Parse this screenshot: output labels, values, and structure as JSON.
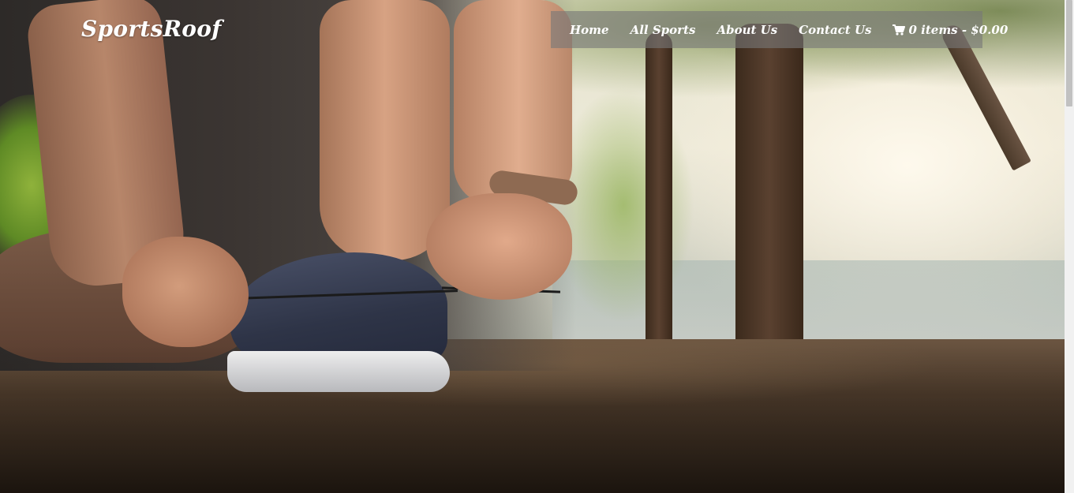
{
  "brand": {
    "logo_text": "SportsRoof"
  },
  "nav": {
    "items": [
      {
        "label": "Home"
      },
      {
        "label": "All Sports"
      },
      {
        "label": "About Us"
      },
      {
        "label": "Contact Us"
      }
    ],
    "cart": {
      "icon": "shopping-cart-icon",
      "label": "0 items - $0.00"
    }
  },
  "hero": {
    "image": "runner-tying-shoelace-photo"
  },
  "colors": {
    "nav_background": "#787878",
    "text": "#ffffff",
    "scrollbar_track": "#f1f1f1",
    "scrollbar_thumb": "#c1c1c1"
  }
}
